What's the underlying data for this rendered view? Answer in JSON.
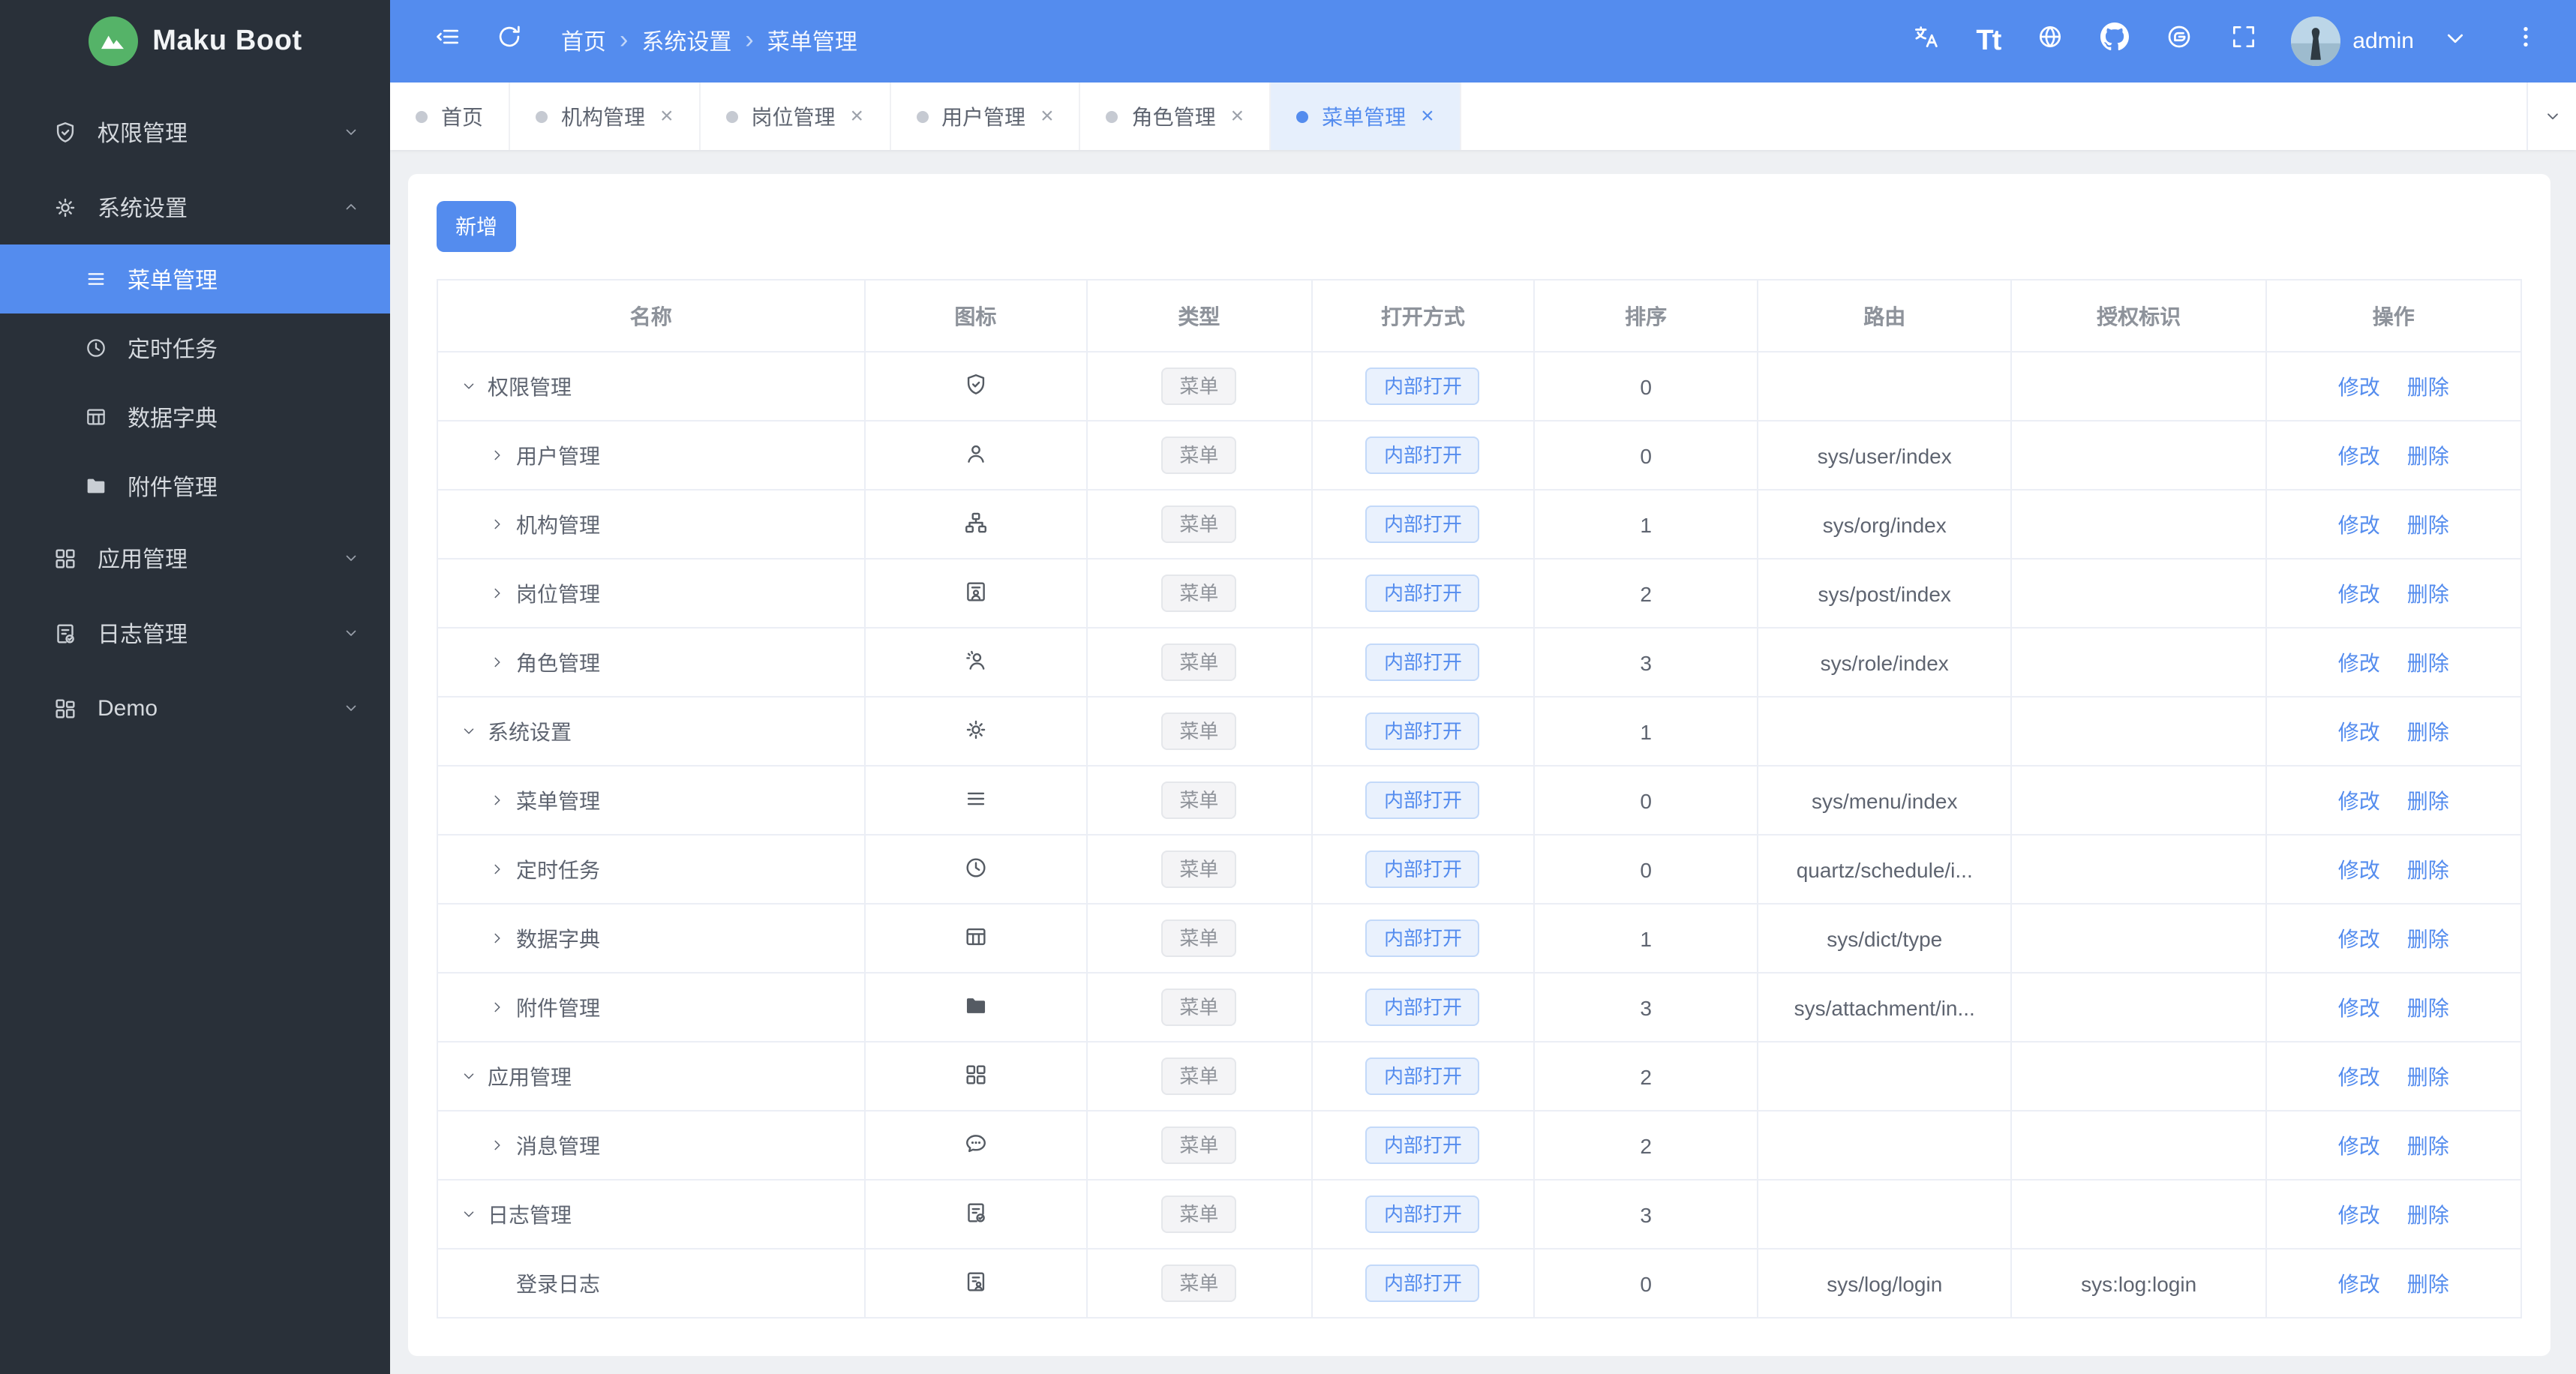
{
  "app": {
    "title": "Maku Boot"
  },
  "colors": {
    "header_blue": "#548CEE",
    "sidebar_dark": "#293039",
    "logo_green": "#55B368",
    "page_gray": "#EEF0F3",
    "active_tab_bg": "#E6EFFC",
    "link_blue": "#548CEE",
    "tag_gray_text": "#8F939A",
    "tag_blue_text": "#548CEE",
    "border": "#EBEEF5"
  },
  "header": {
    "breadcrumb": [
      "首页",
      "系统设置",
      "菜单管理"
    ],
    "icons": [
      "collapse-sidebar",
      "refresh",
      "translate",
      "font-size",
      "globe",
      "github",
      "gitee",
      "fullscreen"
    ],
    "user": "admin"
  },
  "sidebar": {
    "items": [
      {
        "id": "auth",
        "label": "权限管理",
        "icon": "shield-check",
        "expanded": false
      },
      {
        "id": "system",
        "label": "系统设置",
        "icon": "gear",
        "expanded": true,
        "children": [
          {
            "id": "menu",
            "label": "菜单管理",
            "icon": "menu-lines",
            "active": true
          },
          {
            "id": "schedule",
            "label": "定时任务",
            "icon": "clock",
            "active": false
          },
          {
            "id": "dict",
            "label": "数据字典",
            "icon": "dict-table",
            "active": false
          },
          {
            "id": "attachment",
            "label": "附件管理",
            "icon": "folder",
            "active": false
          }
        ]
      },
      {
        "id": "app",
        "label": "应用管理",
        "icon": "grid",
        "expanded": false
      },
      {
        "id": "log",
        "label": "日志管理",
        "icon": "log-doc",
        "expanded": false
      },
      {
        "id": "demo",
        "label": "Demo",
        "icon": "grid-alt",
        "expanded": false
      }
    ]
  },
  "tabs": [
    {
      "label": "首页",
      "closable": false,
      "active": false
    },
    {
      "label": "机构管理",
      "closable": true,
      "active": false
    },
    {
      "label": "岗位管理",
      "closable": true,
      "active": false
    },
    {
      "label": "用户管理",
      "closable": true,
      "active": false
    },
    {
      "label": "角色管理",
      "closable": true,
      "active": false
    },
    {
      "label": "菜单管理",
      "closable": true,
      "active": true
    }
  ],
  "toolbar": {
    "add_label": "新增"
  },
  "table": {
    "columns": [
      "名称",
      "图标",
      "类型",
      "打开方式",
      "排序",
      "路由",
      "授权标识",
      "操作"
    ],
    "col_widths": [
      "20.5%",
      "10.65%",
      "10.8%",
      "10.7%",
      "10.7%",
      "12.2%",
      "12.2%",
      "12.25%"
    ],
    "actions": {
      "edit": "修改",
      "delete": "删除"
    },
    "rows": [
      {
        "name": "权限管理",
        "arrow": "expanded",
        "indent": 0,
        "icon": "shield-check",
        "type": "菜单",
        "open": "内部打开",
        "sort": "0",
        "route": "",
        "auth": ""
      },
      {
        "name": "用户管理",
        "arrow": "collapsed",
        "indent": 1,
        "icon": "user",
        "type": "菜单",
        "open": "内部打开",
        "sort": "0",
        "route": "sys/user/index",
        "auth": ""
      },
      {
        "name": "机构管理",
        "arrow": "collapsed",
        "indent": 1,
        "icon": "org-tree",
        "type": "菜单",
        "open": "内部打开",
        "sort": "1",
        "route": "sys/org/index",
        "auth": ""
      },
      {
        "name": "岗位管理",
        "arrow": "collapsed",
        "indent": 1,
        "icon": "id-badge",
        "type": "菜单",
        "open": "内部打开",
        "sort": "2",
        "route": "sys/post/index",
        "auth": ""
      },
      {
        "name": "角色管理",
        "arrow": "collapsed",
        "indent": 1,
        "icon": "user-role",
        "type": "菜单",
        "open": "内部打开",
        "sort": "3",
        "route": "sys/role/index",
        "auth": ""
      },
      {
        "name": "系统设置",
        "arrow": "expanded",
        "indent": 0,
        "icon": "gear",
        "type": "菜单",
        "open": "内部打开",
        "sort": "1",
        "route": "",
        "auth": ""
      },
      {
        "name": "菜单管理",
        "arrow": "collapsed",
        "indent": 1,
        "icon": "menu-lines",
        "type": "菜单",
        "open": "内部打开",
        "sort": "0",
        "route": "sys/menu/index",
        "auth": ""
      },
      {
        "name": "定时任务",
        "arrow": "collapsed",
        "indent": 1,
        "icon": "clock",
        "type": "菜单",
        "open": "内部打开",
        "sort": "0",
        "route": "quartz/schedule/i...",
        "auth": ""
      },
      {
        "name": "数据字典",
        "arrow": "collapsed",
        "indent": 1,
        "icon": "dict-table",
        "type": "菜单",
        "open": "内部打开",
        "sort": "1",
        "route": "sys/dict/type",
        "auth": ""
      },
      {
        "name": "附件管理",
        "arrow": "collapsed",
        "indent": 1,
        "icon": "folder",
        "type": "菜单",
        "open": "内部打开",
        "sort": "3",
        "route": "sys/attachment/in...",
        "auth": ""
      },
      {
        "name": "应用管理",
        "arrow": "expanded",
        "indent": 0,
        "icon": "grid",
        "type": "菜单",
        "open": "内部打开",
        "sort": "2",
        "route": "",
        "auth": ""
      },
      {
        "name": "消息管理",
        "arrow": "collapsed",
        "indent": 1,
        "icon": "message",
        "type": "菜单",
        "open": "内部打开",
        "sort": "2",
        "route": "",
        "auth": ""
      },
      {
        "name": "日志管理",
        "arrow": "expanded",
        "indent": 0,
        "icon": "log-doc",
        "type": "菜单",
        "open": "内部打开",
        "sort": "3",
        "route": "",
        "auth": ""
      },
      {
        "name": "登录日志",
        "arrow": "none",
        "indent": 1,
        "icon": "login-log",
        "type": "菜单",
        "open": "内部打开",
        "sort": "0",
        "route": "sys/log/login",
        "auth": "sys:log:login"
      }
    ]
  }
}
